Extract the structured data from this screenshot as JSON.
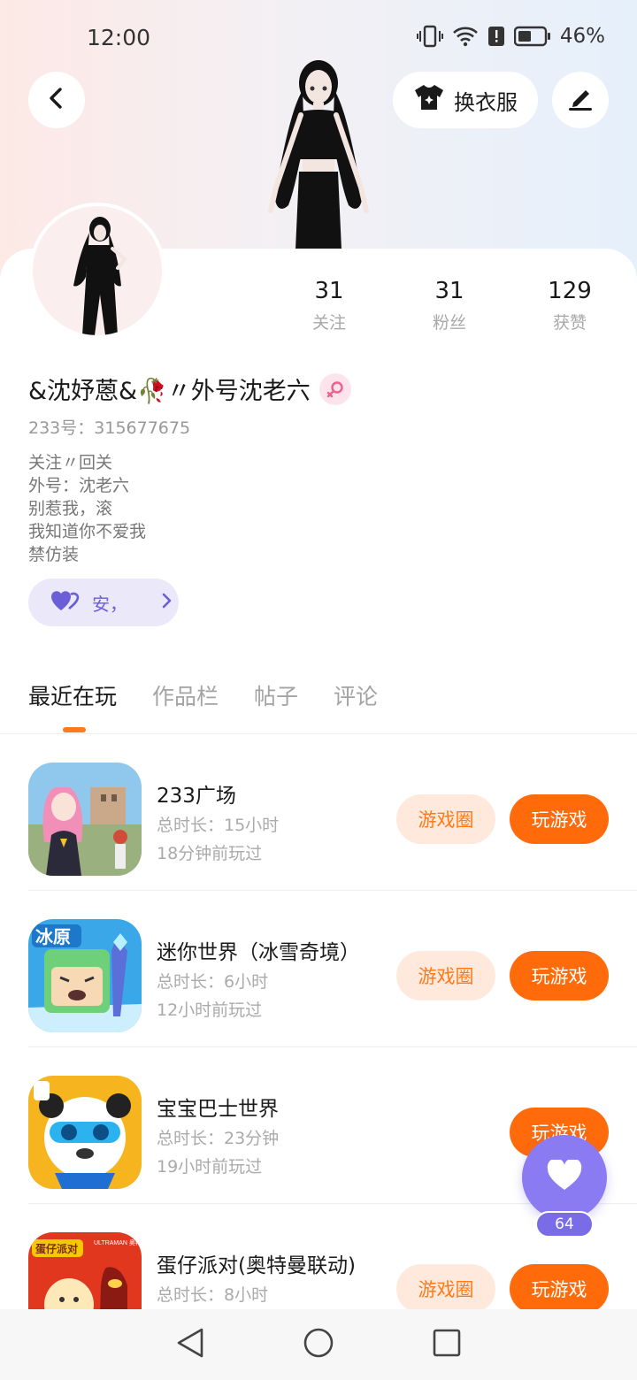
{
  "status_bar": {
    "time": "12:00",
    "battery": "46%"
  },
  "header": {
    "outfit_label": "换衣服"
  },
  "stats": [
    {
      "count": "31",
      "label": "关注"
    },
    {
      "count": "31",
      "label": "粉丝"
    },
    {
      "count": "129",
      "label": "获赞"
    }
  ],
  "profile": {
    "username": "&沈妤蒽&🥀〃外号沈老六",
    "user_id": "233号：315677675",
    "bio": [
      "关注〃回关",
      "外号：沈老六",
      "别惹我，滚",
      "我知道你不爱我",
      "禁仿装"
    ],
    "relation_label": "安，"
  },
  "tabs": [
    "最近在玩",
    "作品栏",
    "帖子",
    "评论"
  ],
  "games": [
    {
      "title": "233广场",
      "duration": "总时长：15小时",
      "last_played": "18分钟前玩过",
      "circle_label": "游戏圈",
      "play_label": "玩游戏"
    },
    {
      "title": "迷你世界（冰雪奇境）",
      "duration": "总时长：6小时",
      "last_played": "12小时前玩过",
      "circle_label": "游戏圈",
      "play_label": "玩游戏"
    },
    {
      "title": "宝宝巴士世界",
      "duration": "总时长：23分钟",
      "last_played": "19小时前玩过",
      "circle_label": "",
      "play_label": "玩游戏"
    },
    {
      "title": "蛋仔派对(奥特曼联动)",
      "duration": "总时长：8小时",
      "last_played": "",
      "circle_label": "游戏圈",
      "play_label": "玩游戏"
    }
  ],
  "game_icons": {
    "game1_label": "",
    "game2_label": "冰原",
    "game4_label_top": "蛋仔派对",
    "game4_label_right": "ULTRAMAN 奥特曼"
  },
  "floating_like": {
    "count": "64"
  },
  "colors": {
    "accent": "#ff6a0a",
    "accent_light": "#ffe9dc",
    "purple": "#8b7bf2"
  }
}
